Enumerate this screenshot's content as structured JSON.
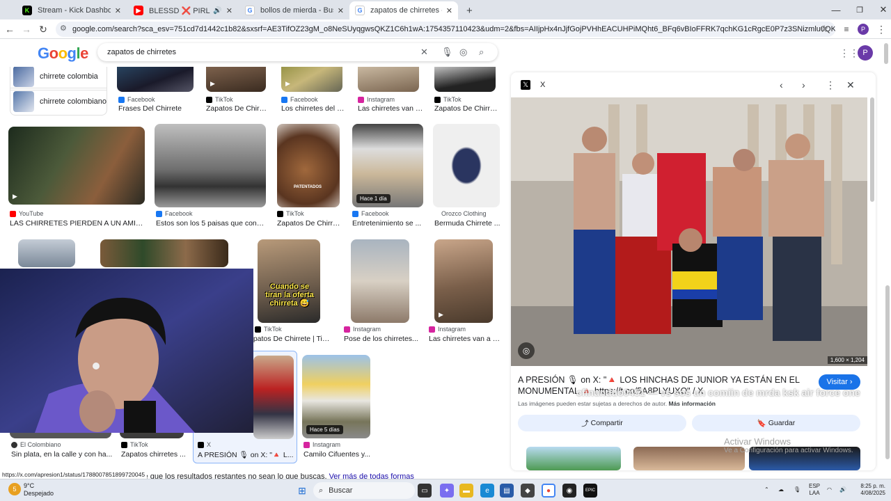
{
  "browser": {
    "tabs": [
      {
        "label": "Stream - Kick Dashboard",
        "favicon": "K",
        "color": "#53fc18"
      },
      {
        "label": "BLESSD ❌ PIRLO | ZIPLOC",
        "favicon": "▶",
        "color": "#ff0000"
      },
      {
        "label": "bollos de mierda - Buscar con",
        "favicon": "G",
        "color": "#4285f4"
      },
      {
        "label": "zapatos de chirretes - Buscar co",
        "favicon": "G",
        "color": "#4285f4"
      }
    ],
    "url": "google.com/search?sca_esv=751cd7d1442c1b82&sxsrf=AE3TifOZ23gM_o8NeSUyqgwsQKZ1C6h1wA:1754357110423&udm=2&fbs=AIIjpHx4nJjfGojPVHhEACUHPiMQht6_BFq6vBIoFFRK7qchKG1cRgcE0P7z3SNizmlu0QK8MgiKsZ0mDOS2di7FnzoXfcyjU12QCb...",
    "profile_initial": "P"
  },
  "google": {
    "logo": "Google",
    "query": "zapatos de chirretes"
  },
  "related": [
    {
      "label": "chirrete colombia"
    },
    {
      "label": "chirrete colombiano"
    }
  ],
  "row0": [
    {
      "source": "Facebook",
      "caption": "Frases Del Chirrete"
    },
    {
      "source": "TikTok",
      "caption": "Zapatos De Chirret..."
    },
    {
      "source": "Facebook",
      "caption": "Los chirretes del b..."
    },
    {
      "source": "Instagram",
      "caption": "Las chirretes van a..."
    },
    {
      "source": "TikTok",
      "caption": "Zapatos De Chirret..."
    }
  ],
  "row1": [
    {
      "source": "YouTube",
      "caption": "LAS CHIRRETES PIERDEN A UN AMIGO..."
    },
    {
      "source": "Facebook",
      "caption": "Estos son los 5 paisas que con s..."
    },
    {
      "source": "TikTok",
      "caption": "Zapatos De Chirret...",
      "thumb_text": "PATENTADOS"
    },
    {
      "source": "Facebook",
      "caption": "Entretenimiento se ...",
      "badge": "Hace 1 día"
    },
    {
      "source": "Orozco Clothing",
      "caption": "Bermuda Chirrete ..."
    }
  ],
  "row2": [
    {
      "source": "TikTok",
      "caption": "apatos De Chirrete | TikT...",
      "thumb_text": "Cuando se tiran la oferta chirreta 😅"
    },
    {
      "source": "Instagram",
      "caption": "Pose de los chirretes..."
    },
    {
      "source": "Instagram",
      "caption": "Las chirretes van a P..."
    }
  ],
  "row3": [
    {
      "source": "El Colombiano",
      "caption": "Sin plata, en la calle y con ha..."
    },
    {
      "source": "TikTok",
      "caption": "Zapatos chirretes ..."
    },
    {
      "source": "X",
      "caption": "A PRESIÓN 🎙 on X: \"🔺 L..."
    },
    {
      "source": "Instagram",
      "caption": "Camilo Cifuentes y...",
      "badge": "Hace 5 días"
    }
  ],
  "status_url": "https://x.com/apresion1/status/1788007851899720045",
  "more_results": {
    "prefix": "ble que los resultados restantes no sean lo que buscas.",
    "link": "Ver más de todas formas"
  },
  "preview": {
    "source": "X",
    "dimensions": "1,600 × 1,204",
    "title": "A PRESIÓN 🎙 on X: \"🔺 LOS HINCHAS DE JUNIOR YA ESTÁN EN EL MONUMENTAL 🔺 https://t.co/5A8PLYUXO\" / X",
    "visit": "Visitar",
    "rights": "Las imágenes pueden estar sujetas a derechos de autor.",
    "more_info": "Más información",
    "share": "Compartir",
    "save": "Guardar"
  },
  "overlay_text": "cfinunduo0451 — vs sos un comiin de mrda ksk air force one",
  "activate": {
    "line1": "Activar Windows",
    "line2": "Ve a Configuración para activar Windows."
  },
  "taskbar": {
    "weather_temp": "9°C",
    "weather_desc": "Despejado",
    "weather_badge": "5",
    "search": "Buscar",
    "lang1": "ESP",
    "lang2": "LAA",
    "time": "8:25 p. m.",
    "date": "4/08/2025"
  }
}
